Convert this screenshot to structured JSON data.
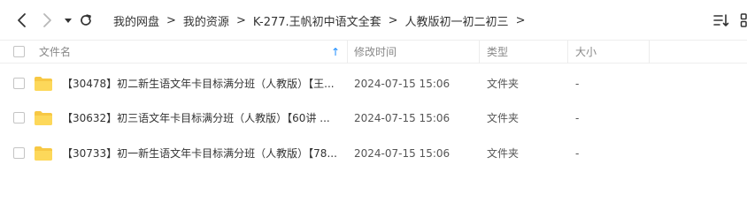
{
  "toolbar": {
    "breadcrumbs": [
      {
        "label": "我的网盘"
      },
      {
        "label": "我的资源"
      },
      {
        "label": "K-277.王帆初中语文全套"
      },
      {
        "label": "人教版初一初二初三"
      }
    ],
    "separator": ">",
    "icons": {
      "back": "chevron-left-icon",
      "forward": "chevron-right-icon",
      "history": "caret-down-icon",
      "refresh": "refresh-icon",
      "sort": "sort-list-icon",
      "view": "grid-view-icon"
    }
  },
  "table": {
    "columns": {
      "name": "文件名",
      "modified": "修改时间",
      "type": "类型",
      "size": "大小"
    },
    "sort_indicator": "↑",
    "rows": [
      {
        "name": "【30478】初二新生语文年卡目标满分班（人教版）【王...",
        "modified": "2024-07-15 15:06",
        "type": "文件夹",
        "size": "-"
      },
      {
        "name": "【30632】初三语文年卡目标满分班（人教版）【60讲 ...",
        "modified": "2024-07-15 15:06",
        "type": "文件夹",
        "size": "-"
      },
      {
        "name": "【30733】初一新生语文年卡目标满分班（人教版）【78...",
        "modified": "2024-07-15 15:06",
        "type": "文件夹",
        "size": "-"
      }
    ]
  },
  "colors": {
    "folder": "#f7c844",
    "accent": "#1a8cff",
    "border": "#eeeeee"
  }
}
